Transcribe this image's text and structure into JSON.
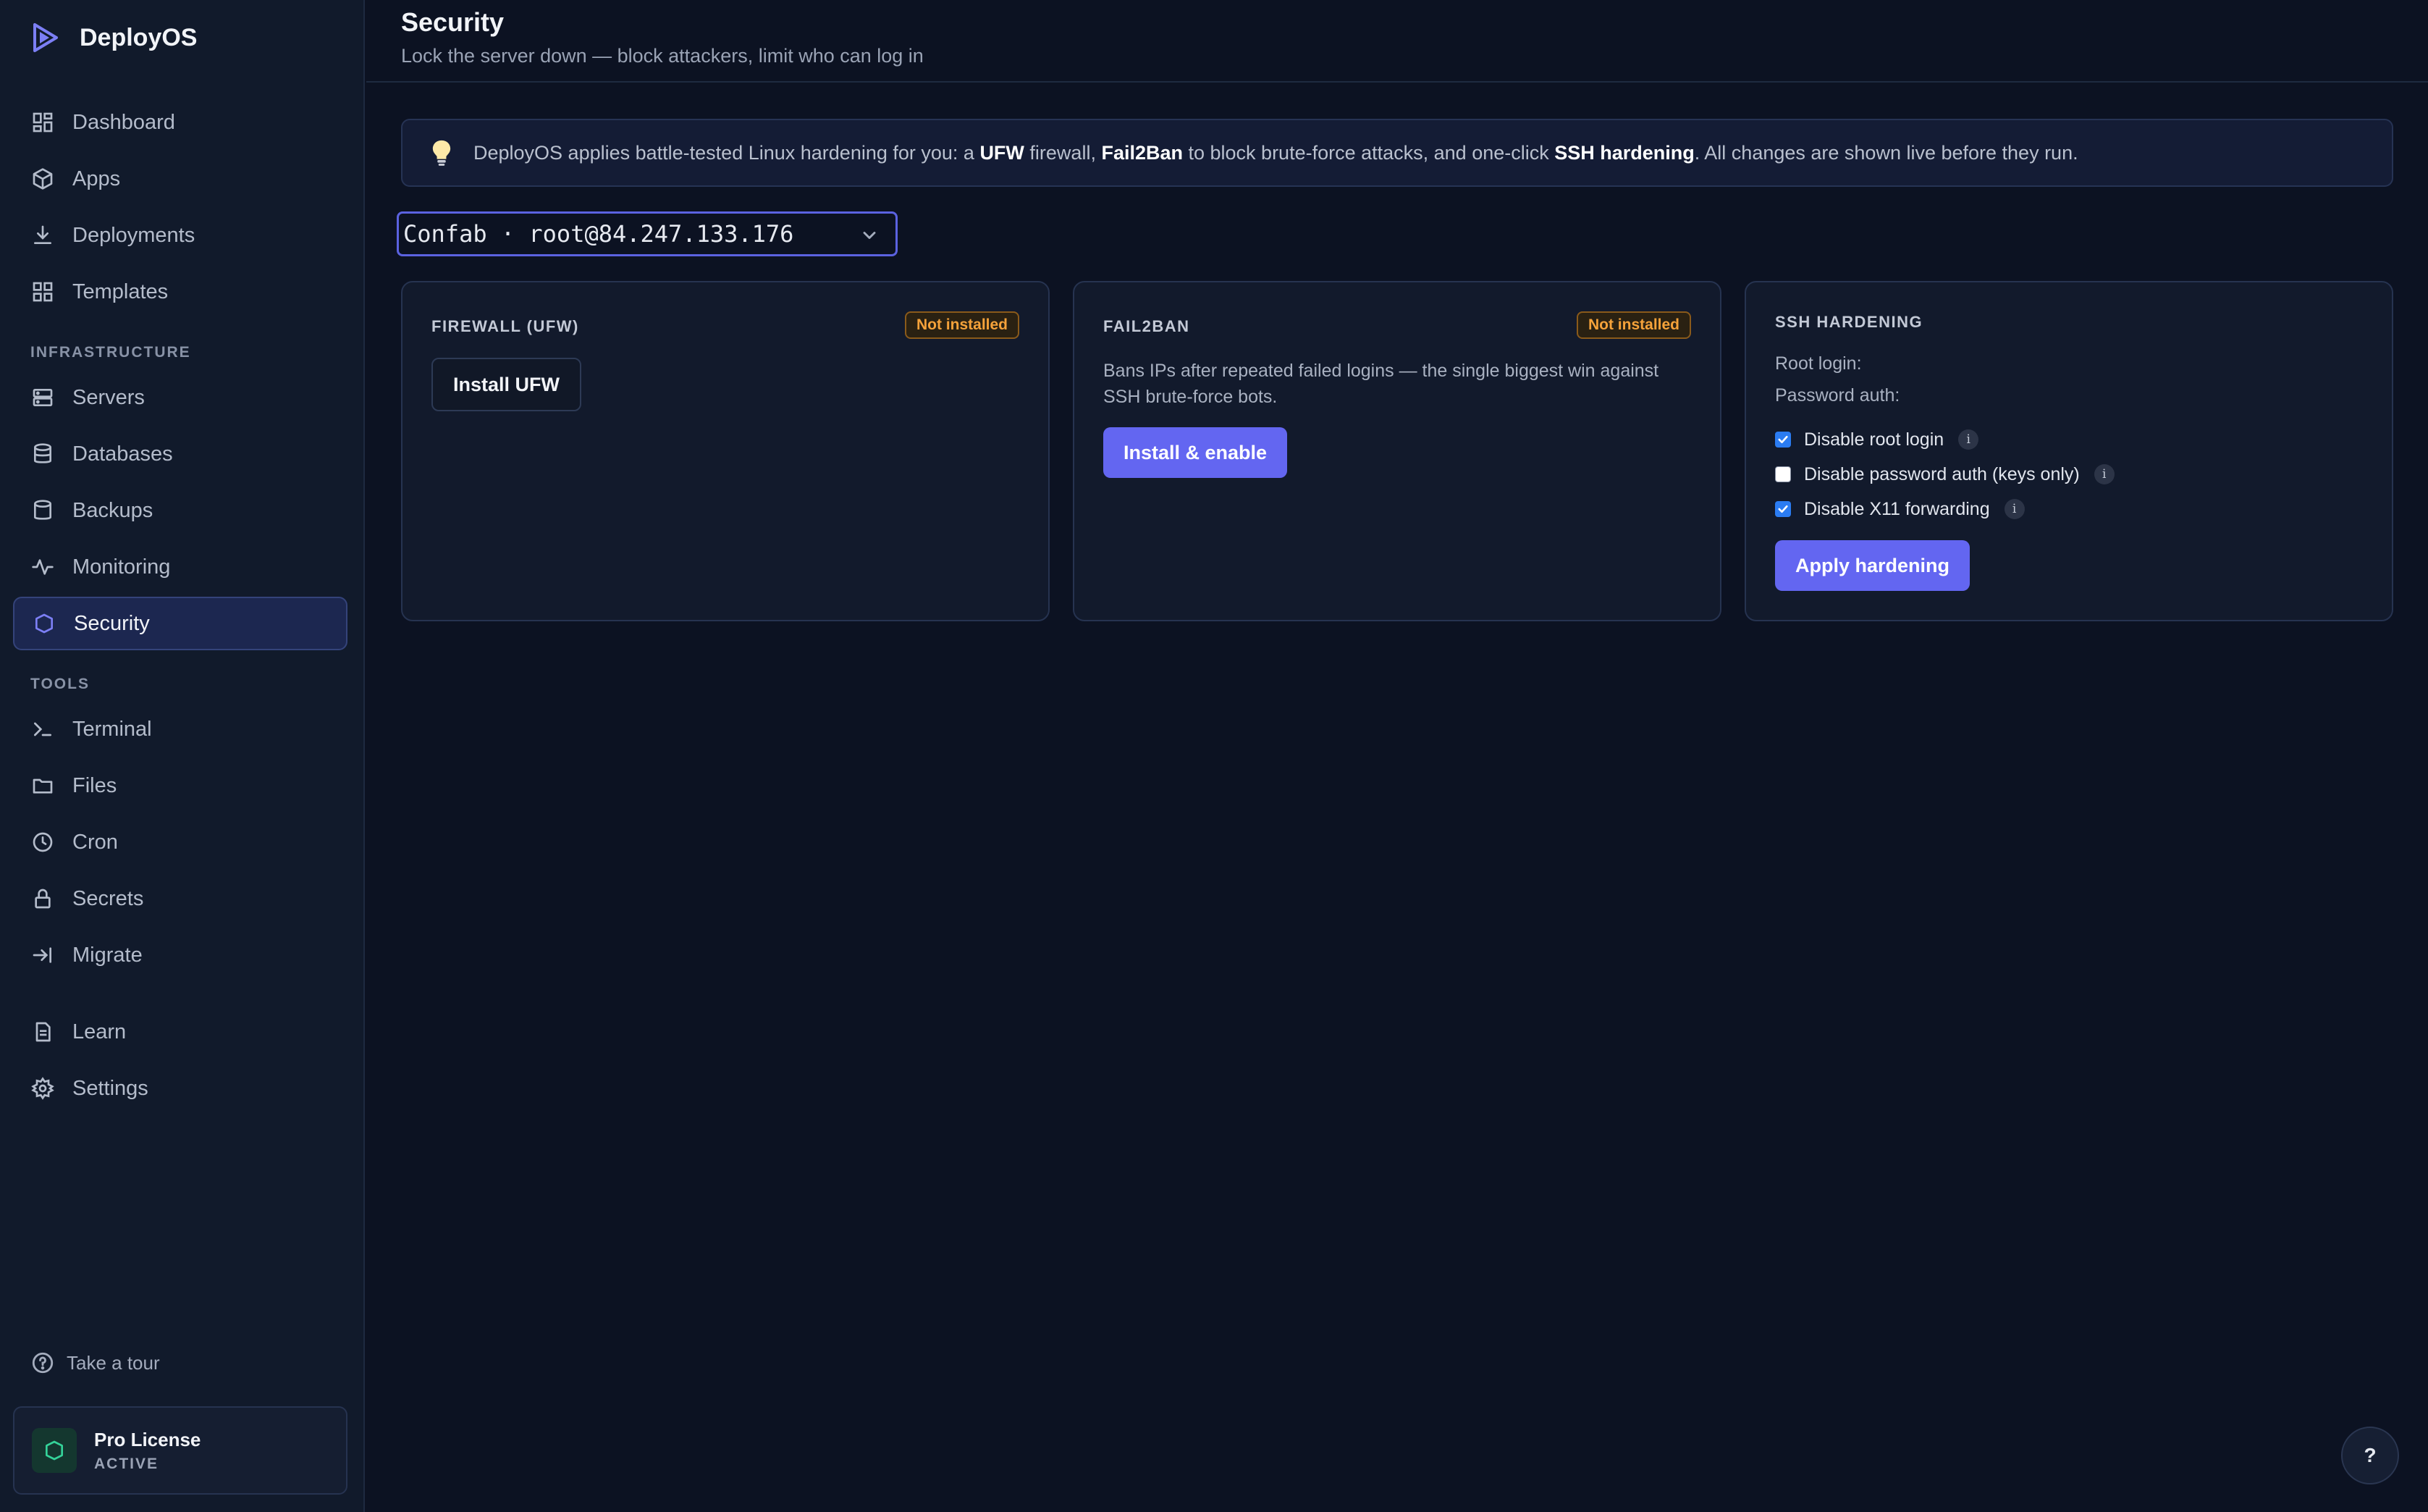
{
  "app": {
    "name": "DeployOS"
  },
  "sidebar": {
    "items": [
      {
        "label": "Dashboard",
        "icon": "dashboard-icon"
      },
      {
        "label": "Apps",
        "icon": "box-icon"
      },
      {
        "label": "Deployments",
        "icon": "download-icon"
      },
      {
        "label": "Templates",
        "icon": "grid-icon"
      }
    ],
    "infra_label": "INFRASTRUCTURE",
    "infra_items": [
      {
        "label": "Servers",
        "icon": "server-icon"
      },
      {
        "label": "Databases",
        "icon": "database-icon"
      },
      {
        "label": "Backups",
        "icon": "backup-icon"
      },
      {
        "label": "Monitoring",
        "icon": "activity-icon"
      },
      {
        "label": "Security",
        "icon": "shield-icon",
        "active": true
      }
    ],
    "tools_label": "TOOLS",
    "tools_items": [
      {
        "label": "Terminal",
        "icon": "terminal-icon"
      },
      {
        "label": "Files",
        "icon": "folder-icon"
      },
      {
        "label": "Cron",
        "icon": "clock-icon"
      },
      {
        "label": "Secrets",
        "icon": "lock-icon"
      },
      {
        "label": "Migrate",
        "icon": "migrate-icon"
      }
    ],
    "bottom_items": [
      {
        "label": "Learn",
        "icon": "document-icon"
      },
      {
        "label": "Settings",
        "icon": "gear-icon"
      }
    ],
    "tour_label": "Take a tour",
    "license": {
      "title": "Pro License",
      "status": "ACTIVE"
    }
  },
  "header": {
    "title": "Security",
    "subtitle": "Lock the server down — block attackers, limit who can log in"
  },
  "banner": {
    "t1": "DeployOS applies battle-tested Linux hardening for you: a ",
    "b1": "UFW",
    "t2": " firewall, ",
    "b2": "Fail2Ban",
    "t3": " to block brute-force attacks, and one-click ",
    "b3": "SSH hardening",
    "t4": ". All changes are shown live before they run."
  },
  "server_select": {
    "value": "Confab · root@84.247.133.176"
  },
  "cards": {
    "firewall": {
      "title": "FIREWALL (UFW)",
      "status": "Not installed",
      "button": "Install UFW"
    },
    "fail2ban": {
      "title": "FAIL2BAN",
      "status": "Not installed",
      "description": "Bans IPs after repeated failed logins — the single biggest win against SSH brute-force bots.",
      "button": "Install & enable"
    },
    "ssh": {
      "title": "SSH HARDENING",
      "root_login_label": "Root login:",
      "password_auth_label": "Password auth:",
      "options": [
        {
          "label": "Disable root login",
          "checked": true
        },
        {
          "label": "Disable password auth (keys only)",
          "checked": false
        },
        {
          "label": "Disable X11 forwarding",
          "checked": true
        }
      ],
      "button": "Apply hardening"
    }
  },
  "help_label": "?",
  "colors": {
    "accent": "#6366f1",
    "warning": "#f5a23a",
    "background": "#0c1222",
    "sidebar": "#111a2b"
  }
}
